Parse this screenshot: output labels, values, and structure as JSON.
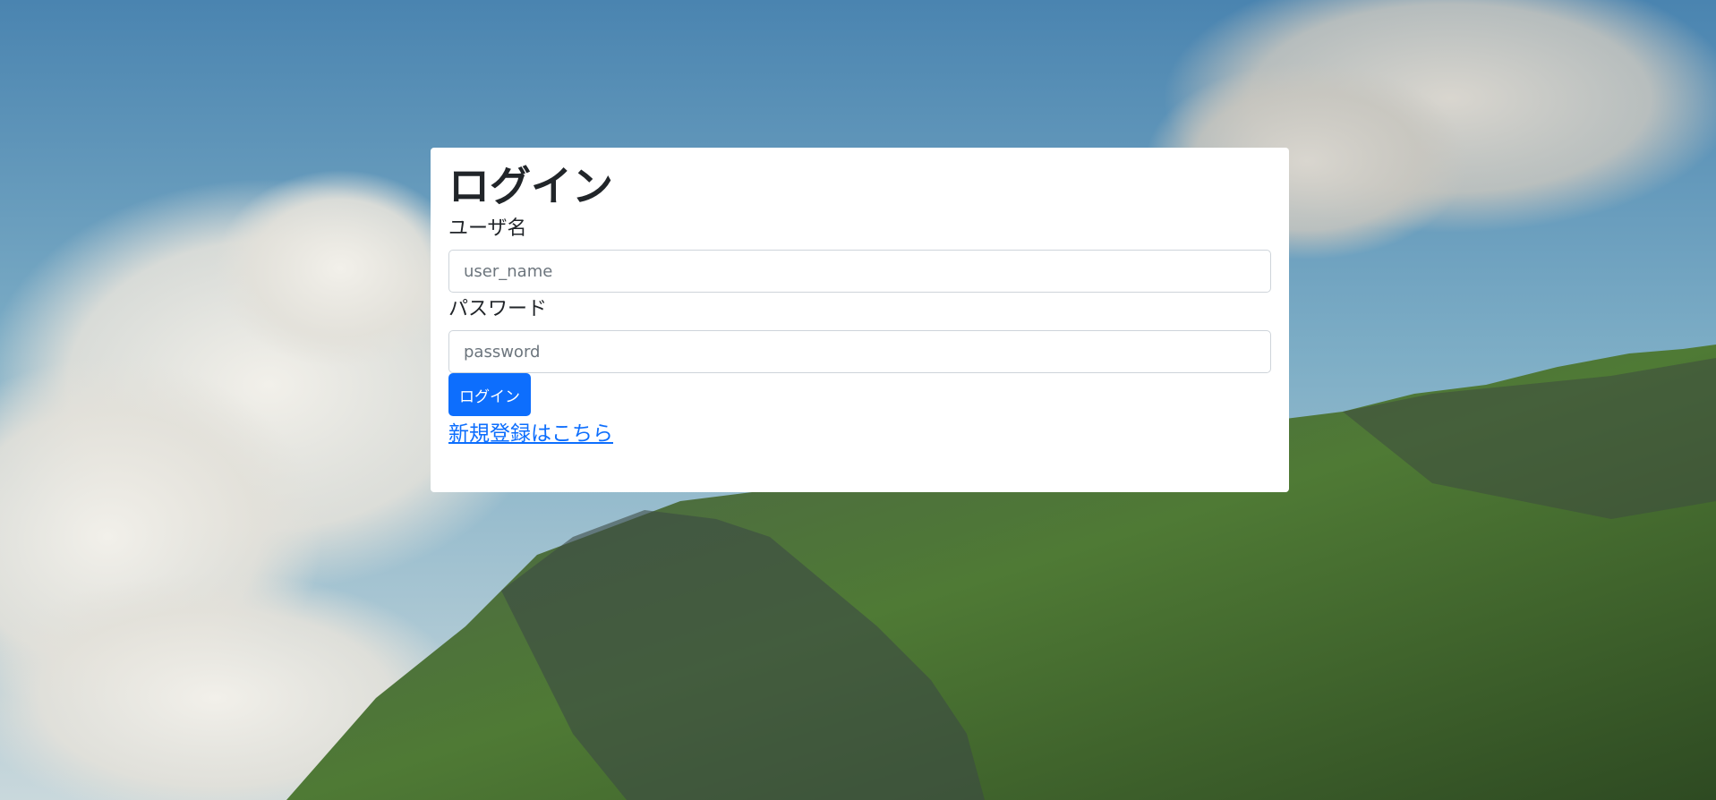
{
  "page": {
    "background": "mountain-landscape-photo"
  },
  "login_form": {
    "title": "ログイン",
    "username": {
      "label": "ユーザ名",
      "placeholder": "user_name",
      "value": ""
    },
    "password": {
      "label": "パスワード",
      "placeholder": "password",
      "value": ""
    },
    "submit_label": "ログイン",
    "register_link": "新規登録はこちら"
  },
  "colors": {
    "primary": "#0d6efd",
    "text": "#212529",
    "card_background": "#ffffff",
    "input_border": "#ced4da"
  }
}
